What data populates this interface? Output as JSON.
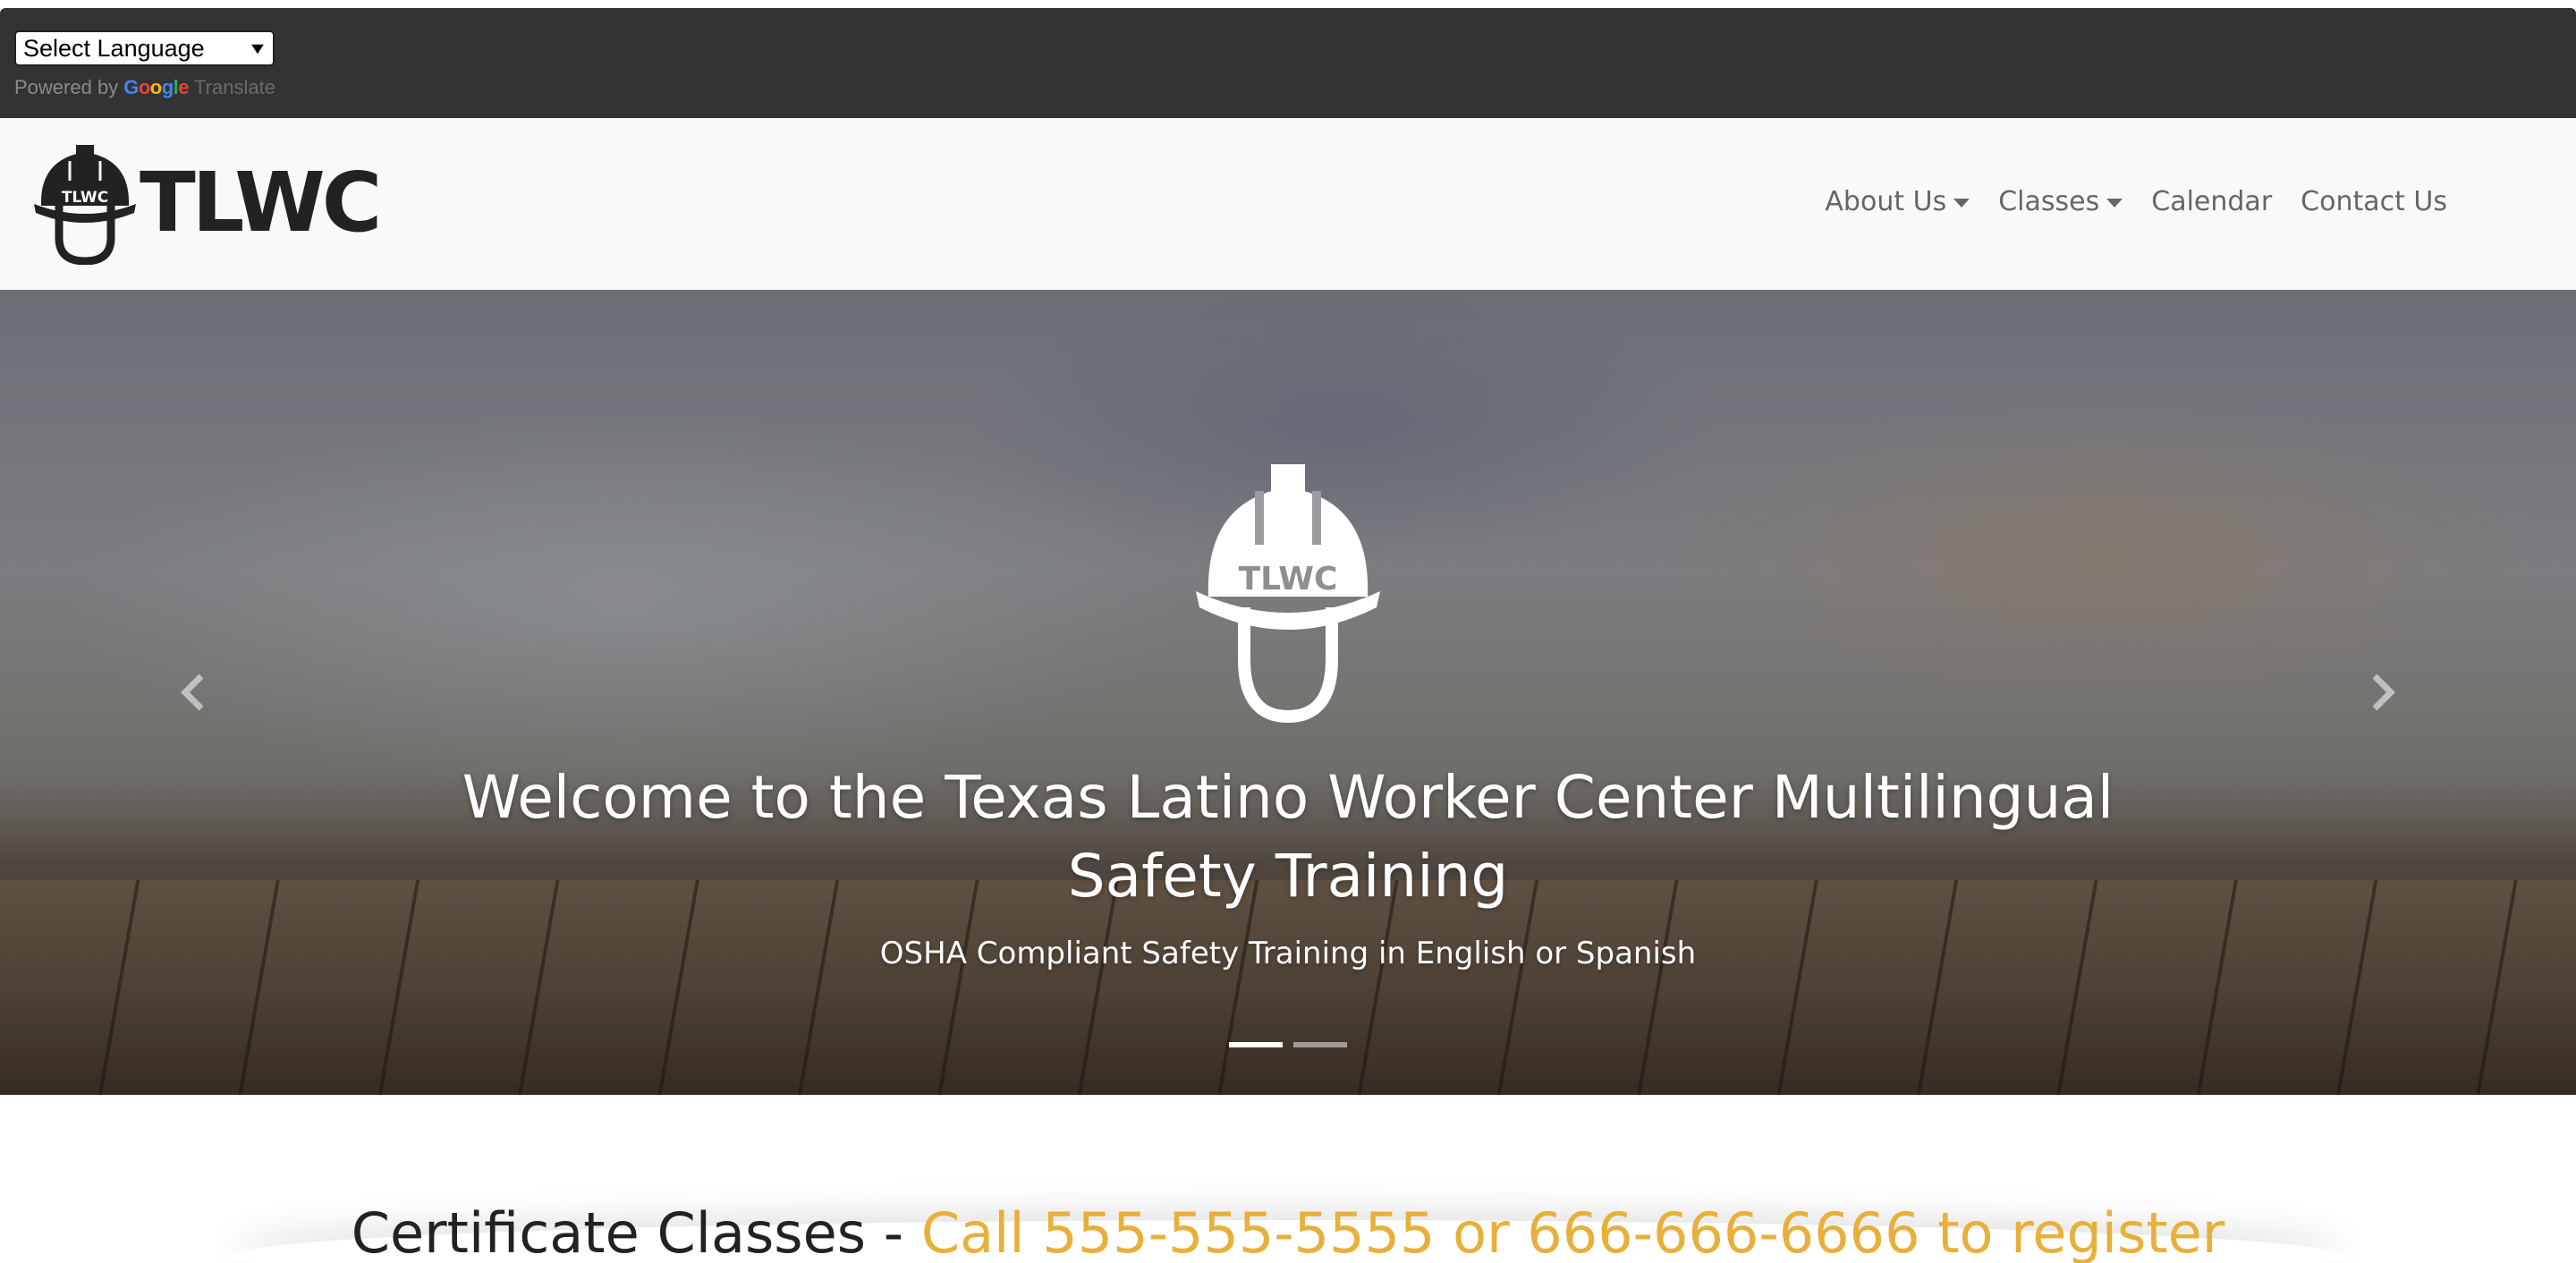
{
  "translate_bar": {
    "select_value": "Select Language",
    "powered_by": "Powered by",
    "google_logo_text": "Google",
    "translate_link": "Translate"
  },
  "navbar": {
    "brand_text": "TLWC",
    "logo_badge_text": "TLWC",
    "items": [
      {
        "label": "About Us",
        "dropdown": true
      },
      {
        "label": "Classes",
        "dropdown": true
      },
      {
        "label": "Calendar",
        "dropdown": false
      },
      {
        "label": "Contact Us",
        "dropdown": false
      }
    ]
  },
  "hero": {
    "logo_badge_text": "TLWC",
    "title": "Welcome to the Texas Latino Worker Center Multilingual Safety Training",
    "subtitle": "OSHA Compliant Safety Training in English or Spanish",
    "prev_icon": "chevron-left-icon",
    "next_icon": "chevron-right-icon",
    "slide_count": 2,
    "active_slide": 1
  },
  "certificate": {
    "heading_prefix": "Certificate Classes - ",
    "heading_accent": "Call 555-555-5555 or 666-666-6666 to register",
    "accent_color": "#e8b03a"
  }
}
